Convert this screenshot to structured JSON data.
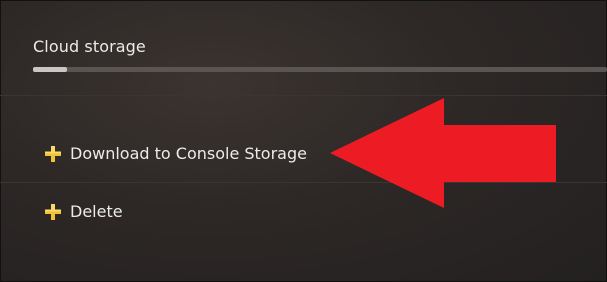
{
  "header": {
    "title": "Cloud storage",
    "storage_used_fraction": 0.06
  },
  "menu": {
    "items": [
      {
        "label": "Download to Console Storage",
        "icon": "ps-plus-icon"
      },
      {
        "label": "Delete",
        "icon": "ps-plus-icon"
      }
    ]
  },
  "colors": {
    "arrow": "#ed1c24",
    "ps_plus_gold": "#f2c232"
  }
}
